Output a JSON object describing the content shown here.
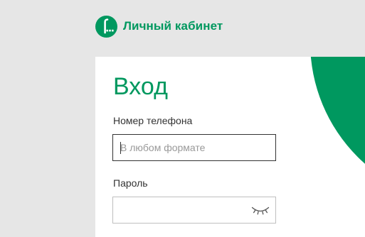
{
  "colors": {
    "brand": "#00985f",
    "page_background": "#e6e6e6",
    "card_background": "#ffffff",
    "text": "#333333"
  },
  "header": {
    "logo_icon": "megafon-logo-icon",
    "title": "Личный кабинет"
  },
  "login": {
    "heading": "Вход",
    "phone": {
      "label": "Номер телефона",
      "placeholder": "В любом формате",
      "value": ""
    },
    "password": {
      "label": "Пароль",
      "value": "",
      "toggle_icon": "eye-closed-icon"
    }
  }
}
